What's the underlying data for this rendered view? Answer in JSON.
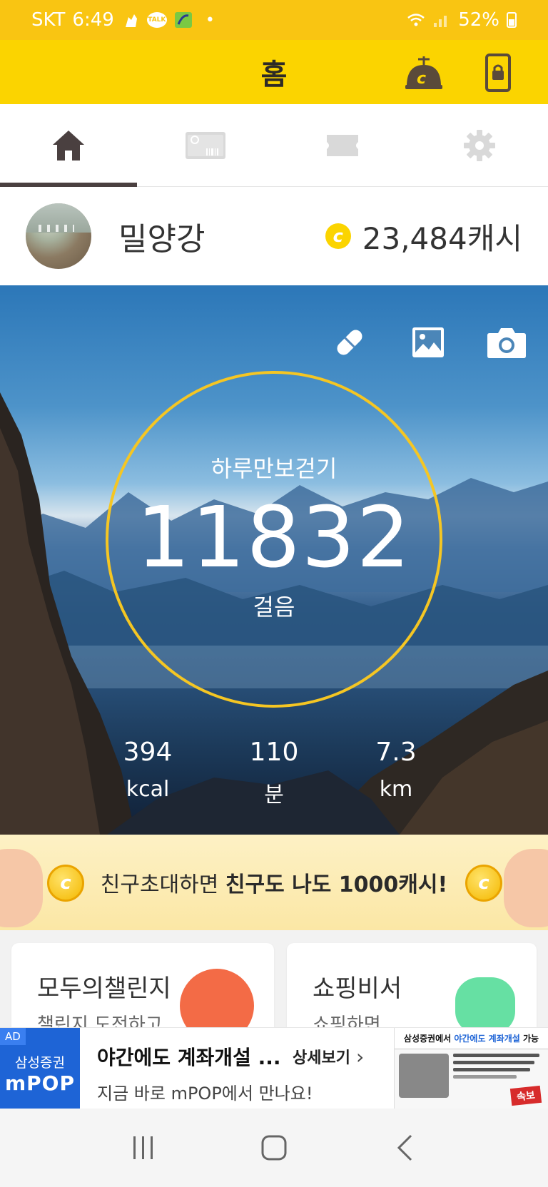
{
  "status_bar": {
    "carrier": "SKT",
    "time": "6:49",
    "talk_badge": "TALK",
    "battery": "52%"
  },
  "header": {
    "title": "홈"
  },
  "tabs": [
    {
      "icon": "home-icon",
      "active": true
    },
    {
      "icon": "gift-card-icon",
      "active": false
    },
    {
      "icon": "ticket-icon",
      "active": false
    },
    {
      "icon": "gear-icon",
      "active": false
    }
  ],
  "profile": {
    "name": "밀양강",
    "cash_coin": "c",
    "cash": "23,484캐시"
  },
  "hero": {
    "label": "하루만보걷기",
    "steps": "11832",
    "unit": "걸음",
    "stats": [
      {
        "value": "394",
        "unit": "kcal"
      },
      {
        "value": "110",
        "unit": "분"
      },
      {
        "value": "7.3",
        "unit": "km"
      }
    ]
  },
  "banner": {
    "text_normal": "친구초대하면 ",
    "text_bold": "친구도 나도 1000캐시!",
    "coin": "c"
  },
  "cards": [
    {
      "title": "모두의챌린지",
      "subtitle": "챌린지 도전하고"
    },
    {
      "title": "쇼핑비서",
      "subtitle": "쇼핑하면"
    }
  ],
  "ad": {
    "tag": "AD",
    "brand_top": "삼성증권",
    "brand_bottom": "mPOP",
    "title": "야간에도 계좌개설 ...",
    "more": "상세보기",
    "subtitle": "지금 바로 mPOP에서 만나요!",
    "thumb_head_a": "삼성증권에서 ",
    "thumb_head_b": "야간에도 계좌개설",
    "thumb_head_c": " 가능",
    "thumb_stamp": "속보"
  },
  "colors": {
    "status_yellow": "#f9c512",
    "header_yellow": "#fbd400",
    "ring": "#f5c623",
    "ad_blue": "#1e64d6"
  }
}
